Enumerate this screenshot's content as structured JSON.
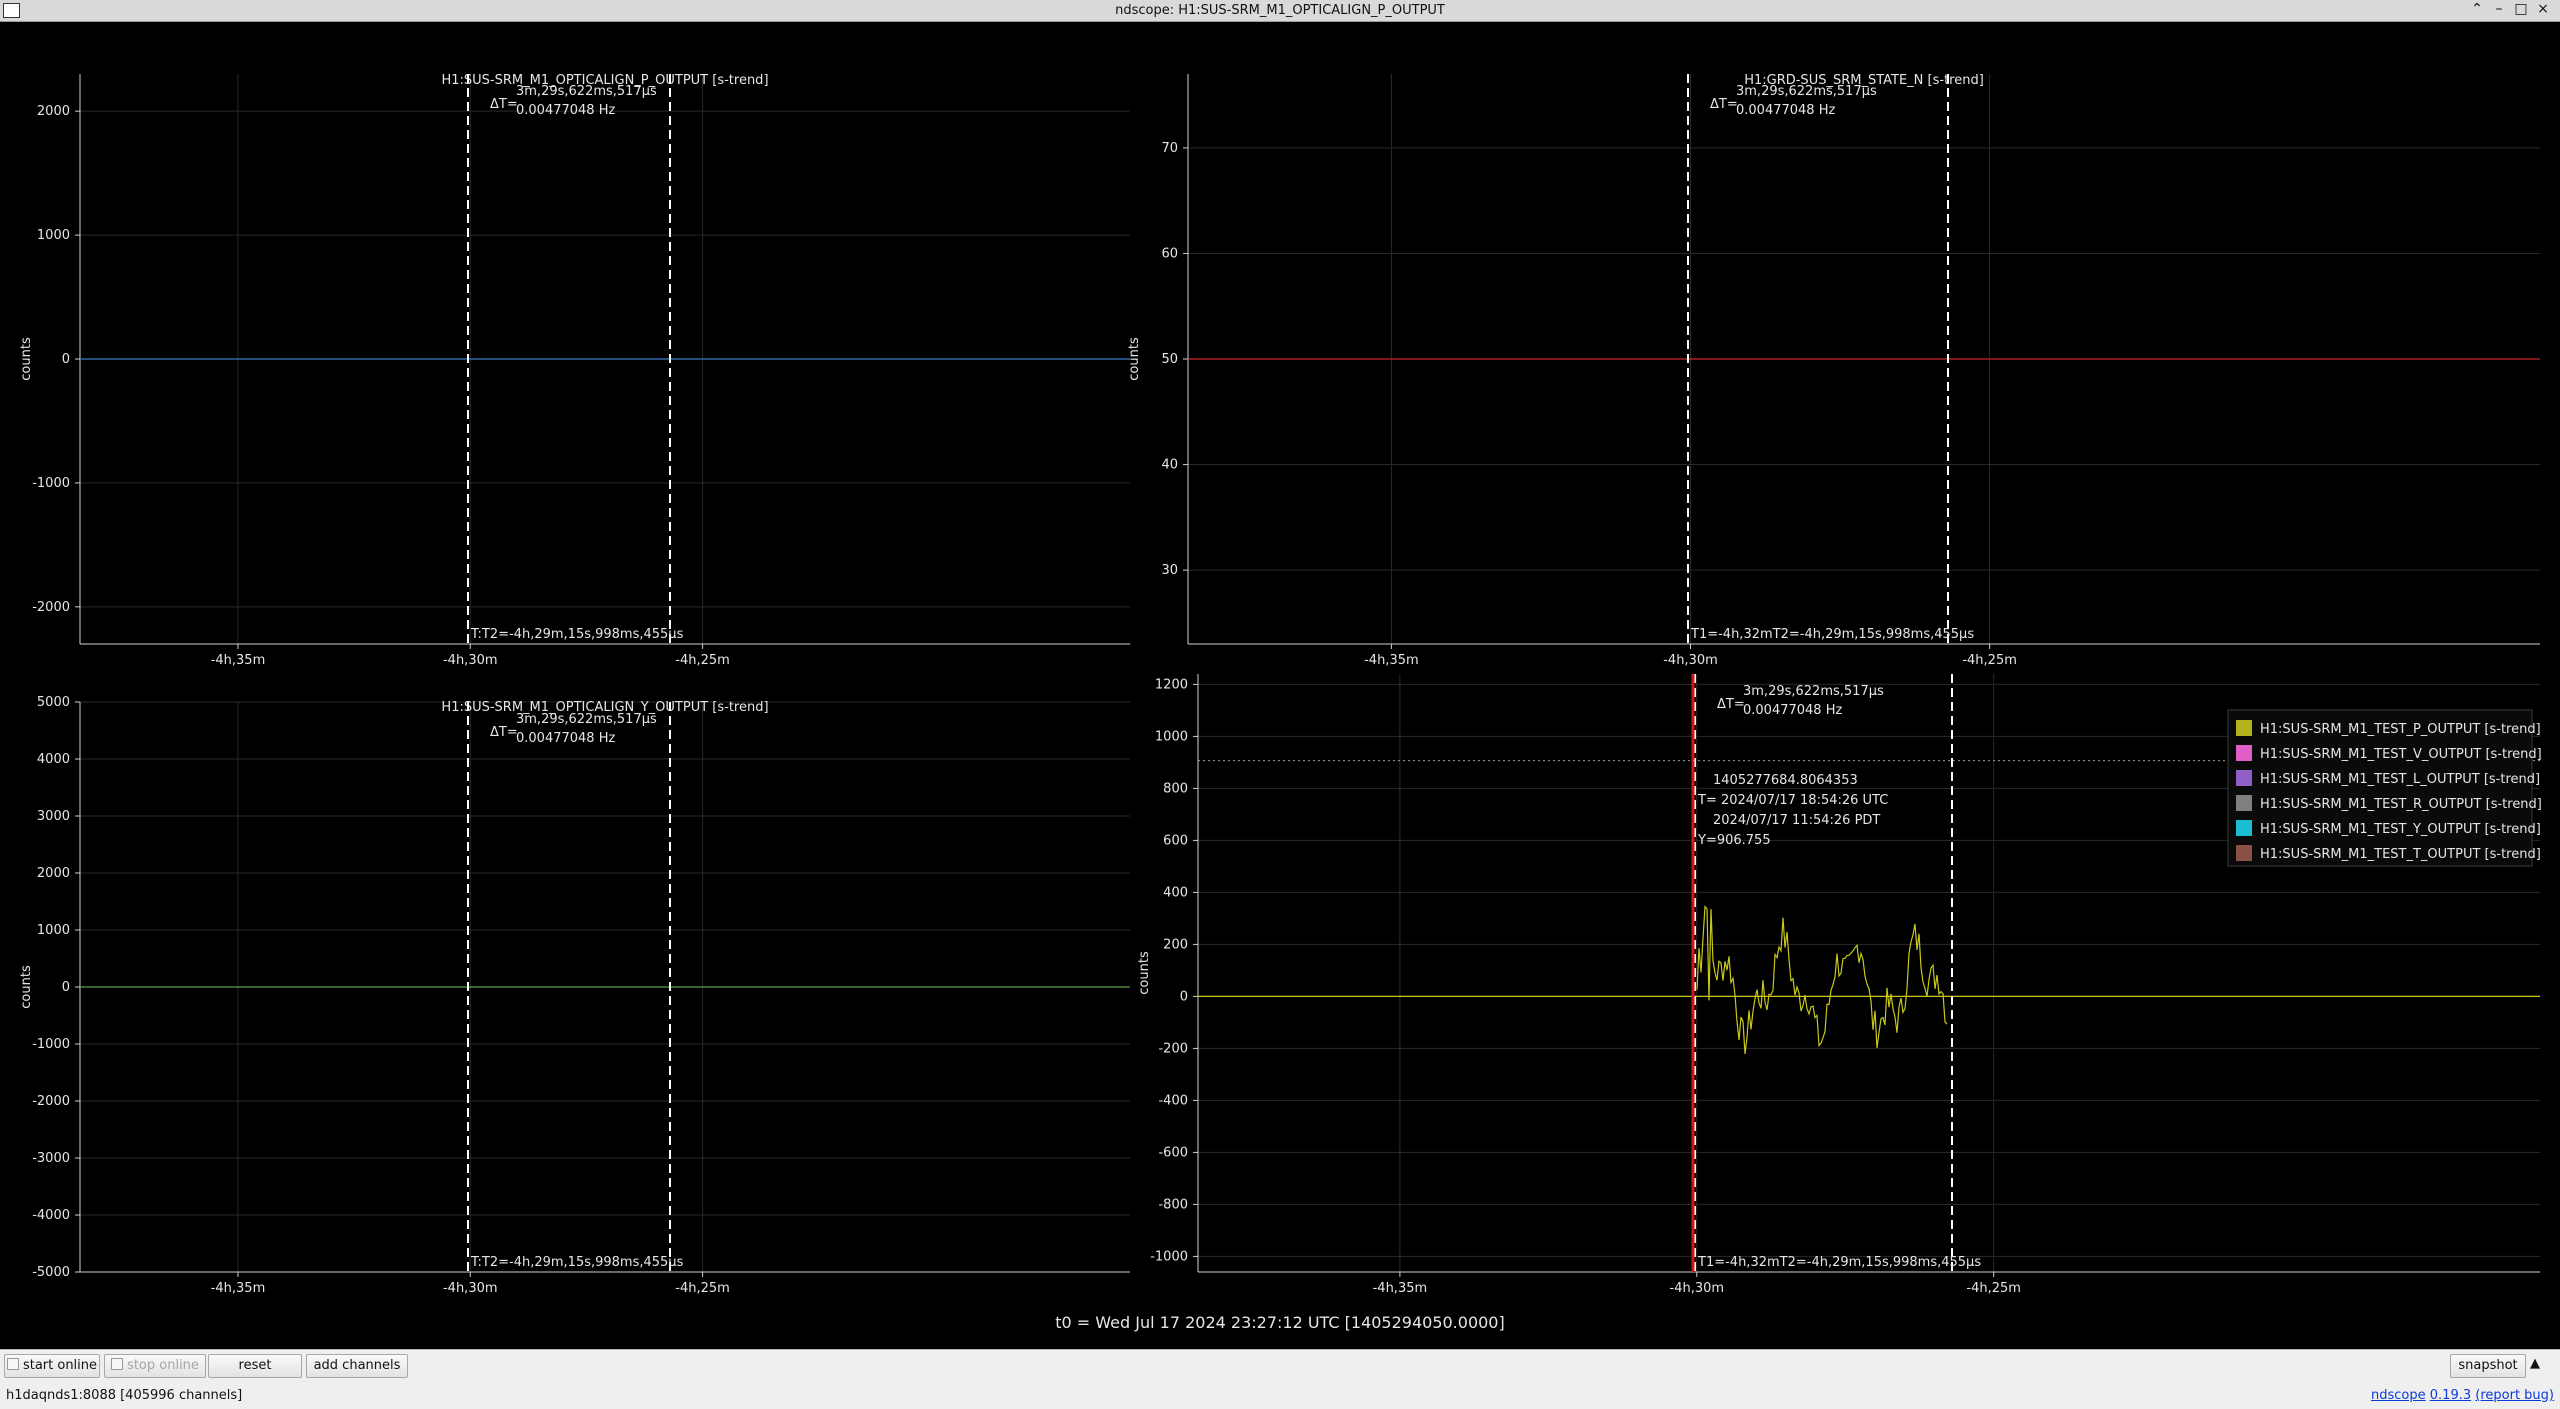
{
  "window": {
    "title": "ndscope: H1:SUS-SRM_M1_OPTICALIGN_P_OUTPUT"
  },
  "colors": {
    "plot_bg": "#000000",
    "text": "#e6e6e6",
    "cursor": "#ffffff",
    "red_cursor": "#d01818",
    "grid": "#2a2a2a",
    "trace_blue": "#3a79c8",
    "trace_red": "#c82828",
    "trace_green": "#5aa04a",
    "trace_yellow": "#c8c818",
    "legend_colors": [
      "#b2b21c",
      "#e05fc6",
      "#8e60c7",
      "#7f7f7f",
      "#19bcd0",
      "#8b5145"
    ]
  },
  "time_axis": {
    "ticks": [
      "-4h,35m",
      "-4h,30m",
      "-4h,25m"
    ],
    "range_minutes": [
      -4.6,
      3.0
    ]
  },
  "plots": [
    {
      "id": "p1",
      "title": "H1:SUS-SRM_M1_OPTICALIGN_P_OUTPUT [s-trend]",
      "ylabel": "counts",
      "yticks": [
        "2000",
        "1000",
        "0",
        "-1000",
        "-2000"
      ],
      "delta_label": "ΔT=",
      "delta_value": "3m,29s,622ms,517μs",
      "delta_freq": "0.00477048 Hz",
      "t_label": "T:T2=-4h,29m,15s,998ms,455μs",
      "trace_value": 0
    },
    {
      "id": "p2",
      "title": "H1:GRD-SUS_SRM_STATE_N [s-trend]",
      "ylabel": "counts",
      "yticks": [
        "70",
        "60",
        "50",
        "40",
        "30"
      ],
      "delta_label": "ΔT=",
      "delta_value": "3m,29s,622ms,517μs",
      "delta_freq": "0.00477048 Hz",
      "t_label": "T1=-4h,32mT2=-4h,29m,15s,998ms,455μs",
      "trace_value": 50
    },
    {
      "id": "p3",
      "title": "H1:SUS-SRM_M1_OPTICALIGN_Y_OUTPUT [s-trend]",
      "ylabel": "counts",
      "yticks": [
        "5000",
        "4000",
        "3000",
        "2000",
        "1000",
        "0",
        "-1000",
        "-2000",
        "-3000",
        "-4000",
        "-5000"
      ],
      "delta_label": "ΔT=",
      "delta_value": "3m,29s,622ms,517μs",
      "delta_freq": "0.00477048 Hz",
      "t_label": "T:T2=-4h,29m,15s,998ms,455μs",
      "trace_value": 0
    },
    {
      "id": "p4",
      "title": "",
      "ylabel": "counts",
      "yticks": [
        "1200",
        "1000",
        "800",
        "600",
        "400",
        "200",
        "0",
        "-200",
        "-400",
        "-600",
        "-800",
        "-1000"
      ],
      "delta_label": "ΔT=",
      "delta_value": "3m,29s,622ms,517μs",
      "delta_freq": "0.00477048 Hz",
      "t_label": "T1=-4h,32mT2=-4h,29m,15s,998ms,455μs",
      "trace_value": 0,
      "crosshair": {
        "gps": "1405277684.8064353",
        "utc": "T= 2024/07/17 18:54:26 UTC",
        "pdt": "2024/07/17 11:54:26 PDT",
        "y": "Y=906.755",
        "y_value": 906.755
      },
      "legend": [
        "H1:SUS-SRM_M1_TEST_P_OUTPUT [s-trend]",
        "H1:SUS-SRM_M1_TEST_V_OUTPUT [s-trend]",
        "H1:SUS-SRM_M1_TEST_L_OUTPUT [s-trend]",
        "H1:SUS-SRM_M1_TEST_R_OUTPUT [s-trend]",
        "H1:SUS-SRM_M1_TEST_Y_OUTPUT [s-trend]",
        "H1:SUS-SRM_M1_TEST_T_OUTPUT [s-trend]"
      ]
    }
  ],
  "t0_label": "t0 = Wed Jul 17 2024 23:27:12 UTC [1405294050.0000]",
  "toolbar": {
    "start_online": "start online",
    "stop_online": "stop online",
    "reset": "reset",
    "add_channels": "add channels",
    "snapshot": "snapshot",
    "expand_icon": "up-triangle-icon"
  },
  "status": {
    "server": "h1daqnds1:8088  [405996 channels]",
    "app_name": "ndscope",
    "version": "0.19.3",
    "report_bug": "(report bug)"
  }
}
